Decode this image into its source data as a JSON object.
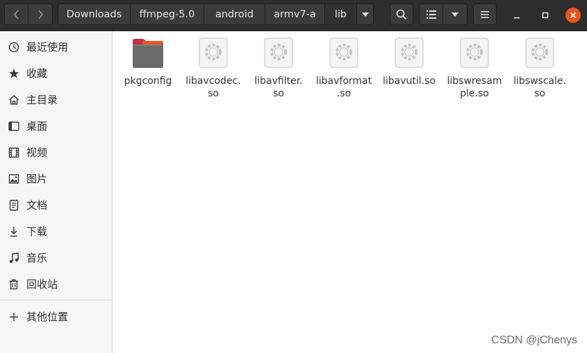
{
  "breadcrumbs": [
    "Downloads",
    "ffmpeg-5.0",
    "android",
    "armv7-a",
    "lib"
  ],
  "sidebar": {
    "items": [
      {
        "label": "最近使用",
        "icon": "clock-icon"
      },
      {
        "label": "收藏",
        "icon": "star-icon"
      },
      {
        "label": "主目录",
        "icon": "home-icon"
      },
      {
        "label": "桌面",
        "icon": "desktop-icon"
      },
      {
        "label": "视频",
        "icon": "video-icon"
      },
      {
        "label": "图片",
        "icon": "picture-icon"
      },
      {
        "label": "文档",
        "icon": "document-icon"
      },
      {
        "label": "下载",
        "icon": "download-icon"
      },
      {
        "label": "音乐",
        "icon": "music-icon"
      },
      {
        "label": "回收站",
        "icon": "trash-icon"
      }
    ],
    "other_locations": "其他位置"
  },
  "files": [
    {
      "name_line1": "pkgconfig",
      "name_line2": "",
      "type": "folder"
    },
    {
      "name_line1": "libavcodec.",
      "name_line2": "so",
      "type": "shared-library"
    },
    {
      "name_line1": "libavfilter.",
      "name_line2": "so",
      "type": "shared-library"
    },
    {
      "name_line1": "libavformat",
      "name_line2": ".so",
      "type": "shared-library"
    },
    {
      "name_line1": "libavutil.so",
      "name_line2": "",
      "type": "shared-library"
    },
    {
      "name_line1": "libswresam",
      "name_line2": "ple.so",
      "type": "shared-library"
    },
    {
      "name_line1": "libswscale.",
      "name_line2": "so",
      "type": "shared-library"
    }
  ],
  "watermark": "CSDN @jChenys",
  "colors": {
    "headerbar": "#2d2d2d",
    "close_button": "#e9541f",
    "folder": "#e95420"
  }
}
